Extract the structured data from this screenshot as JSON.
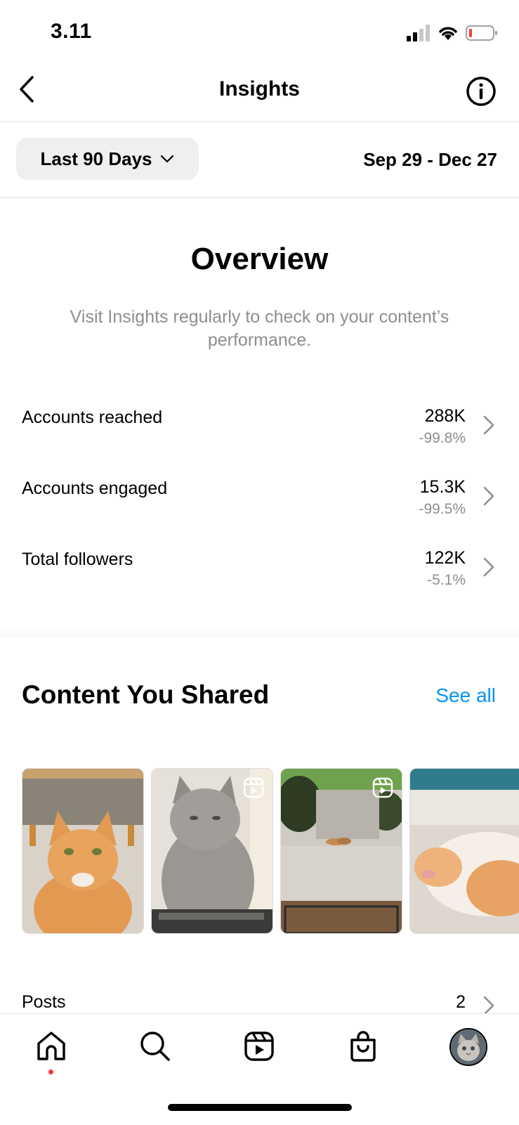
{
  "status_bar": {
    "time": "3.11"
  },
  "nav": {
    "title": "Insights"
  },
  "date_filter": {
    "range_label": "Last 90 Days",
    "date_range": "Sep 29 - Dec 27"
  },
  "overview": {
    "title": "Overview",
    "subtitle": "Visit Insights regularly to check on your content’s performance.",
    "metrics": [
      {
        "label": "Accounts reached",
        "value": "288K",
        "change": "-99.8%"
      },
      {
        "label": "Accounts engaged",
        "value": "15.3K",
        "change": "-99.5%"
      },
      {
        "label": "Total followers",
        "value": "122K",
        "change": "-5.1%"
      }
    ]
  },
  "content_shared": {
    "title": "Content You Shared",
    "see_all": "See all",
    "thumbnails": [
      {
        "icon": "none",
        "subject": "orange cat"
      },
      {
        "icon": "reel-icon",
        "subject": "grey cat"
      },
      {
        "icon": "reel-icon",
        "subject": "cat on path"
      },
      {
        "icon": "none",
        "subject": "sleeping cat"
      }
    ],
    "posts": {
      "label": "Posts",
      "count": "2"
    }
  },
  "tabbar": {
    "items": [
      "home-icon",
      "search-icon",
      "reels-icon",
      "shop-icon",
      "profile-avatar"
    ]
  },
  "colors": {
    "link": "#0095f6",
    "muted": "#8e8e8e",
    "notification_dot": "#ff3040"
  }
}
